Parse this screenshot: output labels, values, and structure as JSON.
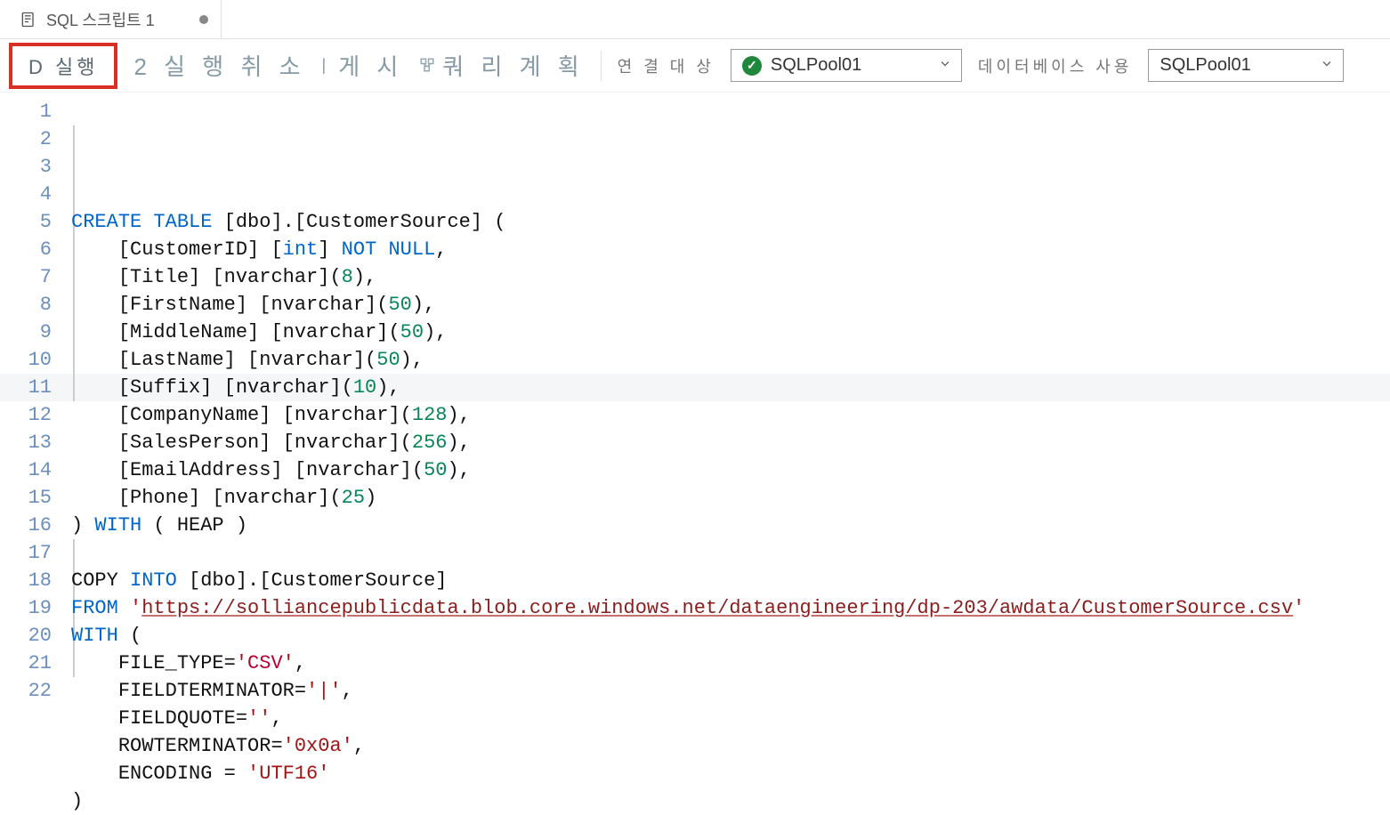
{
  "tab": {
    "title": "SQL 스크립트 1"
  },
  "toolbar": {
    "run_label": "D 실행",
    "cancel_label": "2 실 행 취 소",
    "publish_label": "게 시",
    "plan_label": "쿼 리  계 획",
    "connect_label": "연 결  대 상",
    "connect_value": "SQLPool01",
    "database_label": "데이터베이스 사용",
    "database_value": "SQLPool01"
  },
  "code": {
    "line_count": 22,
    "lines": [
      {
        "tokens": [
          [
            "kw",
            "CREATE"
          ],
          [
            "plain",
            " "
          ],
          [
            "kw",
            "TABLE"
          ],
          [
            "plain",
            " [dbo].[CustomerSource] ("
          ]
        ]
      },
      {
        "indent": "    ",
        "tokens": [
          [
            "plain",
            "[CustomerID] ["
          ],
          [
            "kw",
            "int"
          ],
          [
            "plain",
            "] "
          ],
          [
            "kw",
            "NOT"
          ],
          [
            "plain",
            " "
          ],
          [
            "kw",
            "NULL"
          ],
          [
            "plain",
            ","
          ]
        ]
      },
      {
        "indent": "    ",
        "tokens": [
          [
            "plain",
            "[Title] [nvarchar]("
          ],
          [
            "num",
            "8"
          ],
          [
            "plain",
            "),"
          ]
        ]
      },
      {
        "indent": "    ",
        "tokens": [
          [
            "plain",
            "[FirstName] [nvarchar]("
          ],
          [
            "num",
            "50"
          ],
          [
            "plain",
            "),"
          ]
        ]
      },
      {
        "indent": "    ",
        "tokens": [
          [
            "plain",
            "[MiddleName] [nvarchar]("
          ],
          [
            "num",
            "50"
          ],
          [
            "plain",
            "),"
          ]
        ]
      },
      {
        "indent": "    ",
        "tokens": [
          [
            "plain",
            "[LastName] [nvarchar]("
          ],
          [
            "num",
            "50"
          ],
          [
            "plain",
            "),"
          ]
        ]
      },
      {
        "indent": "    ",
        "highlight": true,
        "tokens": [
          [
            "plain",
            "[Suffix] [nvarchar]("
          ],
          [
            "num",
            "10"
          ],
          [
            "plain",
            "),"
          ]
        ]
      },
      {
        "indent": "    ",
        "tokens": [
          [
            "plain",
            "[CompanyName] [nvarchar]("
          ],
          [
            "num",
            "128"
          ],
          [
            "plain",
            "),"
          ]
        ]
      },
      {
        "indent": "    ",
        "tokens": [
          [
            "plain",
            "[SalesPerson] [nvarchar]("
          ],
          [
            "num",
            "256"
          ],
          [
            "plain",
            "),"
          ]
        ]
      },
      {
        "indent": "    ",
        "tokens": [
          [
            "plain",
            "[EmailAddress] [nvarchar]("
          ],
          [
            "num",
            "50"
          ],
          [
            "plain",
            "),"
          ]
        ]
      },
      {
        "indent": "    ",
        "tokens": [
          [
            "plain",
            "[Phone] [nvarchar]("
          ],
          [
            "num",
            "25"
          ],
          [
            "plain",
            ")"
          ]
        ]
      },
      {
        "tokens": [
          [
            "plain",
            ") "
          ],
          [
            "kw",
            "WITH"
          ],
          [
            "plain",
            " ( HEAP )"
          ]
        ]
      },
      {
        "tokens": []
      },
      {
        "tokens": [
          [
            "plain",
            "COPY "
          ],
          [
            "kw",
            "INTO"
          ],
          [
            "plain",
            " [dbo].[CustomerSource]"
          ]
        ]
      },
      {
        "tokens": [
          [
            "kw",
            "FROM"
          ],
          [
            "plain",
            " "
          ],
          [
            "str",
            "'"
          ],
          [
            "url",
            "https://solliancepublicdata.blob.core.windows.net/dataengineering/dp-203/awdata/CustomerSource.csv"
          ],
          [
            "str",
            "'"
          ]
        ]
      },
      {
        "tokens": [
          [
            "kw",
            "WITH"
          ],
          [
            "plain",
            " ("
          ]
        ]
      },
      {
        "indent": "    ",
        "tokens": [
          [
            "plain",
            "FILE_TYPE="
          ],
          [
            "str",
            "'"
          ],
          [
            "kwred",
            "CSV"
          ],
          [
            "str",
            "'"
          ],
          [
            "plain",
            ","
          ]
        ]
      },
      {
        "indent": "    ",
        "tokens": [
          [
            "plain",
            "FIELDTERMINATOR="
          ],
          [
            "str",
            "'|'"
          ],
          [
            "plain",
            ","
          ]
        ]
      },
      {
        "indent": "    ",
        "tokens": [
          [
            "plain",
            "FIELDQUOTE="
          ],
          [
            "str",
            "''"
          ],
          [
            "plain",
            ","
          ]
        ]
      },
      {
        "indent": "    ",
        "tokens": [
          [
            "plain",
            "ROWTERMINATOR="
          ],
          [
            "str",
            "'0x0a'"
          ],
          [
            "plain",
            ","
          ]
        ]
      },
      {
        "indent": "    ",
        "tokens": [
          [
            "plain",
            "ENCODING = "
          ],
          [
            "str",
            "'UTF16'"
          ]
        ]
      },
      {
        "tokens": [
          [
            "plain",
            ")"
          ]
        ]
      }
    ]
  }
}
